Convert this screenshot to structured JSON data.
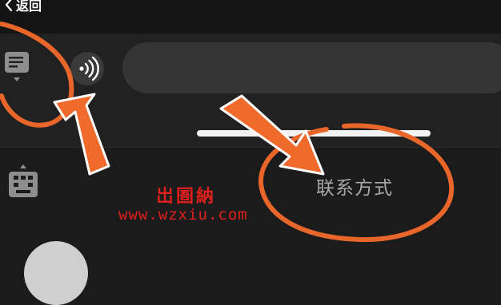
{
  "header": {
    "back_label": "返回"
  },
  "input_bar": {
    "menu_icon": "menu-lines-icon",
    "voice_icon": "voice-wave-icon",
    "message_value": ""
  },
  "panel": {
    "toggle_icon": "keyboard-icon",
    "contact_label": "联系方式"
  },
  "watermark": {
    "logo_text": "岀圄納",
    "url_text": "www.wzxiu.com"
  },
  "colors": {
    "annotation": "#f06a2c",
    "watermark": "#e0201c",
    "background": "#1b1b1b",
    "input": "#353535"
  }
}
